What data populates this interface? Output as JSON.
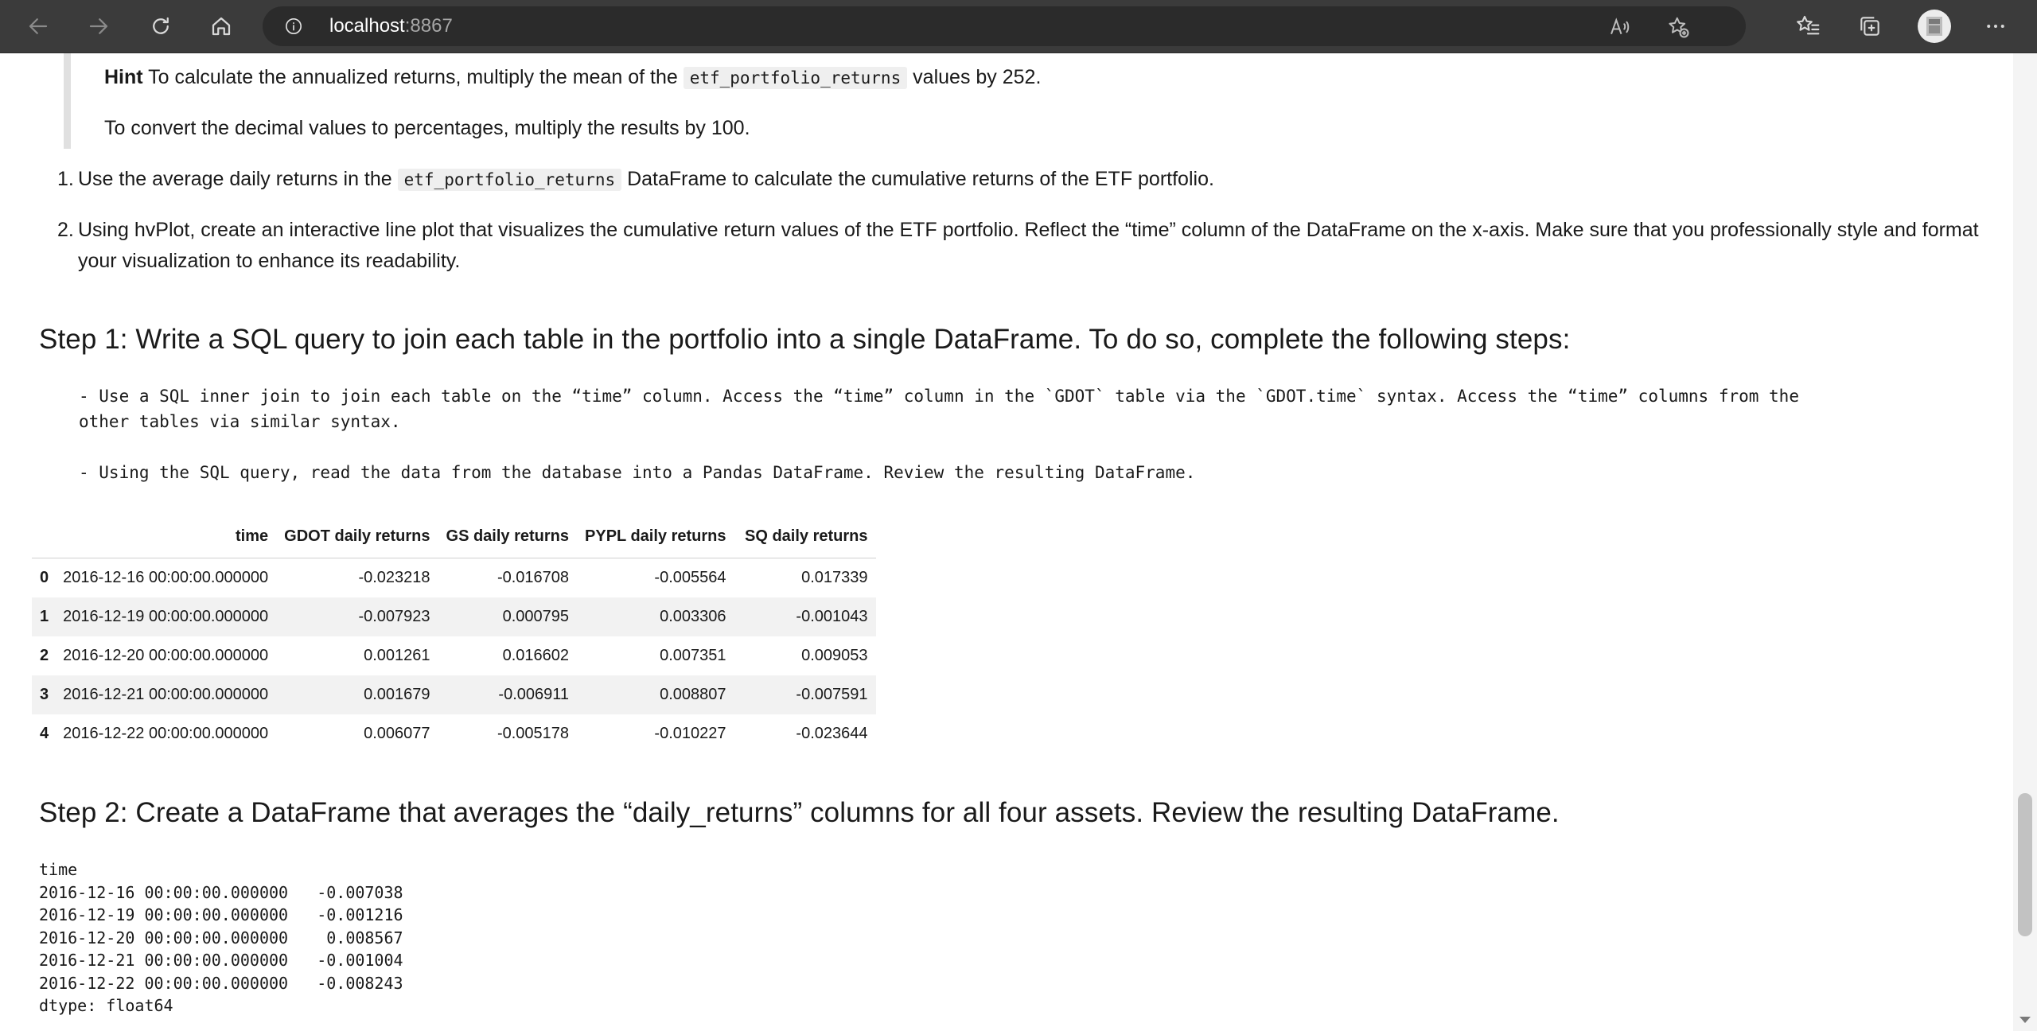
{
  "browser": {
    "url_host": "localhost",
    "url_port": ":8867"
  },
  "hint": {
    "bold": "Hint",
    "text_before": " To calculate the annualized returns, multiply the mean of the ",
    "code": "etf_portfolio_returns",
    "text_after": " values by 252.",
    "line2": "To convert the decimal values to percentages, multiply the results by 100."
  },
  "list": [
    {
      "number": "1.",
      "text_before": "Use the average daily returns in the ",
      "code": "etf_portfolio_returns",
      "text_after": " DataFrame to calculate the cumulative returns of the ETF portfolio."
    },
    {
      "number": "2.",
      "line1": "Using hvPlot, create an interactive line plot that visualizes the cumulative return values of the ETF portfolio. Reflect the “time” column of the DataFrame on the x-axis. Make sure that you professionally style and format",
      "line2": "your visualization to enhance its readability."
    }
  ],
  "step1": {
    "heading": "Step 1: Write a SQL query to join each table in the portfolio into a single DataFrame. To do so, complete the following steps:",
    "bullet1_line1": "- Use a SQL inner join to join each table on the “time” column. Access the “time” column in the `GDOT` table via the `GDOT.time` syntax. Access the “time” columns from the",
    "bullet1_line2": "other tables via similar syntax.",
    "bullet2": "- Using the SQL query, read the data from the database into a Pandas DataFrame. Review the resulting DataFrame."
  },
  "table": {
    "headers": [
      "",
      "time",
      "GDOT daily returns",
      "GS daily returns",
      "PYPL daily returns",
      "SQ daily returns"
    ],
    "rows": [
      [
        "0",
        "2016-12-16 00:00:00.000000",
        "-0.023218",
        "-0.016708",
        "-0.005564",
        "0.017339"
      ],
      [
        "1",
        "2016-12-19 00:00:00.000000",
        "-0.007923",
        "0.000795",
        "0.003306",
        "-0.001043"
      ],
      [
        "2",
        "2016-12-20 00:00:00.000000",
        "0.001261",
        "0.016602",
        "0.007351",
        "0.009053"
      ],
      [
        "3",
        "2016-12-21 00:00:00.000000",
        "0.001679",
        "-0.006911",
        "0.008807",
        "-0.007591"
      ],
      [
        "4",
        "2016-12-22 00:00:00.000000",
        "0.006077",
        "-0.005178",
        "-0.010227",
        "-0.023644"
      ]
    ]
  },
  "step2": {
    "heading": "Step 2: Create a DataFrame that averages the “daily_returns” columns for all four assets. Review the resulting DataFrame.",
    "series_lines": [
      "time",
      "2016-12-16 00:00:00.000000   -0.007038",
      "2016-12-19 00:00:00.000000   -0.001216",
      "2016-12-20 00:00:00.000000    0.008567",
      "2016-12-21 00:00:00.000000   -0.001004",
      "2016-12-22 00:00:00.000000   -0.008243",
      "dtype: float64"
    ]
  }
}
